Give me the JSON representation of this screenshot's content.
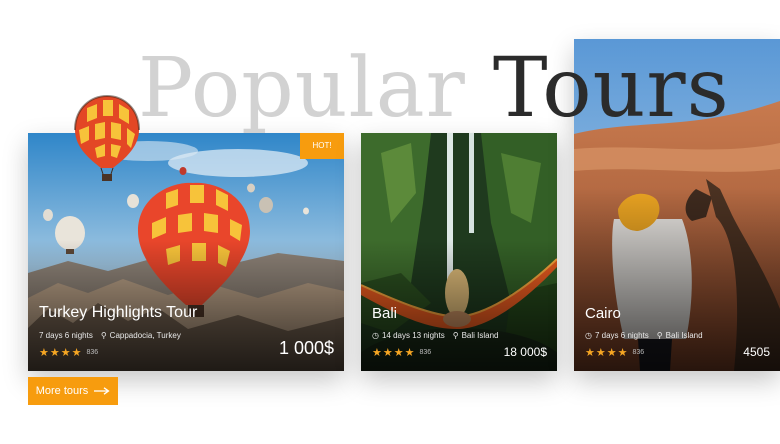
{
  "title": {
    "light": "Popular",
    "dark": "Tours"
  },
  "tours": [
    {
      "name": "Turkey Highlights Tour",
      "duration": "7 days 6 nights",
      "location": "Cappadocia, Turkey",
      "rating": 4,
      "reviews": "836",
      "price": "1 000$",
      "badge": "HOT!"
    },
    {
      "name": "Bali",
      "duration": "14 days 13 nights",
      "location": "Bali Island",
      "rating": 4,
      "reviews": "836",
      "price": "18 000$"
    },
    {
      "name": "Cairo",
      "duration": "7 days 6 nights",
      "location": "Bali Island",
      "rating": 4,
      "reviews": "836",
      "price": "4505"
    }
  ],
  "more_button": {
    "label": "More tours"
  },
  "colors": {
    "accent": "#f79c0e",
    "star": "#f6a623"
  }
}
